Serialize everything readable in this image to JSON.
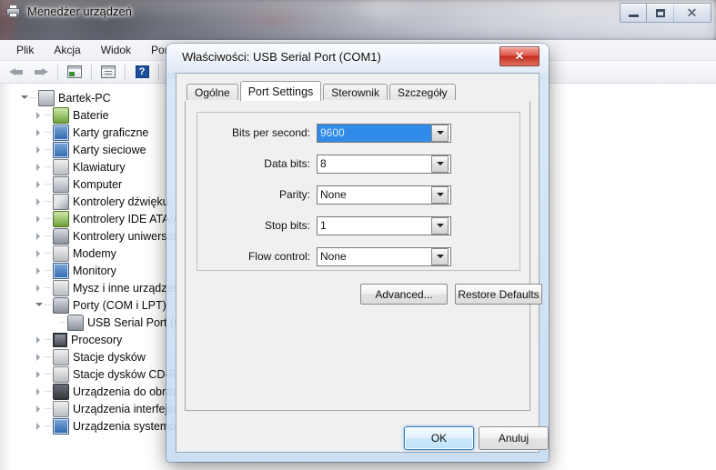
{
  "window": {
    "title": "Menedżer urządzeń",
    "icon": "device-manager-icon",
    "controls": {
      "minimize": "minimize-icon",
      "maximize": "maximize-icon",
      "close": "close-icon"
    }
  },
  "menubar": {
    "items": [
      {
        "label": "Plik"
      },
      {
        "label": "Akcja"
      },
      {
        "label": "Widok"
      },
      {
        "label": "Pomoc"
      }
    ]
  },
  "toolbar": {
    "buttons": [
      {
        "name": "back-arrow-icon"
      },
      {
        "name": "forward-arrow-icon"
      },
      {
        "name": "properties-icon"
      },
      {
        "name": "display-icon"
      },
      {
        "name": "help-icon"
      },
      {
        "name": "scan-hardware-icon"
      }
    ]
  },
  "tree": {
    "root": {
      "label": "Bartek-PC",
      "icon": "computer-icon",
      "expanded": true
    },
    "nodes": [
      {
        "label": "Baterie",
        "icon": "battery-icon",
        "indent": 1,
        "expandable": true,
        "expanded": false
      },
      {
        "label": "Karty graficzne",
        "icon": "display-adapter-icon",
        "indent": 1,
        "expandable": true,
        "expanded": false
      },
      {
        "label": "Karty sieciowe",
        "icon": "network-adapter-icon",
        "indent": 1,
        "expandable": true,
        "expanded": false
      },
      {
        "label": "Klawiatury",
        "icon": "keyboard-icon",
        "indent": 1,
        "expandable": true,
        "expanded": false
      },
      {
        "label": "Komputer",
        "icon": "computer-icon",
        "indent": 1,
        "expandable": true,
        "expanded": false
      },
      {
        "label": "Kontrolery dźwięku, w",
        "icon": "sound-icon",
        "indent": 1,
        "expandable": true,
        "expanded": false
      },
      {
        "label": "Kontrolery IDE ATA/A",
        "icon": "ide-controller-icon",
        "indent": 1,
        "expandable": true,
        "expanded": false
      },
      {
        "label": "Kontrolery uniwersaln",
        "icon": "usb-controller-icon",
        "indent": 1,
        "expandable": true,
        "expanded": false
      },
      {
        "label": "Modemy",
        "icon": "modem-icon",
        "indent": 1,
        "expandable": true,
        "expanded": false
      },
      {
        "label": "Monitory",
        "icon": "monitor-icon",
        "indent": 1,
        "expandable": true,
        "expanded": false
      },
      {
        "label": "Mysz i inne urządzeni",
        "icon": "mouse-icon",
        "indent": 1,
        "expandable": true,
        "expanded": false
      },
      {
        "label": "Porty (COM i LPT)",
        "icon": "port-icon",
        "indent": 1,
        "expandable": true,
        "expanded": true
      },
      {
        "label": "USB Serial Port (CO",
        "icon": "port-icon",
        "indent": 2,
        "expandable": false,
        "expanded": false
      },
      {
        "label": "Procesory",
        "icon": "processor-icon",
        "indent": 1,
        "expandable": true,
        "expanded": false
      },
      {
        "label": "Stacje dysków",
        "icon": "disk-drive-icon",
        "indent": 1,
        "expandable": true,
        "expanded": false
      },
      {
        "label": "Stacje dysków CD-RO",
        "icon": "cd-rom-icon",
        "indent": 1,
        "expandable": true,
        "expanded": false
      },
      {
        "label": "Urządzenia do obrazo",
        "icon": "imaging-device-icon",
        "indent": 1,
        "expandable": true,
        "expanded": false
      },
      {
        "label": "Urządzenia interfejsu",
        "icon": "hid-device-icon",
        "indent": 1,
        "expandable": true,
        "expanded": false
      },
      {
        "label": "Urządzenia systemow",
        "icon": "system-device-icon",
        "indent": 1,
        "expandable": true,
        "expanded": false
      }
    ]
  },
  "dialog": {
    "title": "Właściwości: USB Serial Port (COM1)",
    "close_label": "✕",
    "tabs": [
      {
        "label": "Ogólne",
        "active": false
      },
      {
        "label": "Port Settings",
        "active": true
      },
      {
        "label": "Sterownik",
        "active": false
      },
      {
        "label": "Szczegóły",
        "active": false
      }
    ],
    "fields": [
      {
        "label": "Bits per second:",
        "value": "9600",
        "selected": true
      },
      {
        "label": "Data bits:",
        "value": "8",
        "selected": false
      },
      {
        "label": "Parity:",
        "value": "None",
        "selected": false
      },
      {
        "label": "Stop bits:",
        "value": "1",
        "selected": false
      },
      {
        "label": "Flow control:",
        "value": "None",
        "selected": false
      }
    ],
    "advanced_label": "Advanced...",
    "restore_label": "Restore Defaults",
    "ok_label": "OK",
    "cancel_label": "Anuluj"
  },
  "colors": {
    "selection_blue": "#2f8ae8",
    "close_red": "#c62b1d",
    "focus_blue": "#2c7bbf",
    "dialog_bg": "#f0f0f0"
  }
}
